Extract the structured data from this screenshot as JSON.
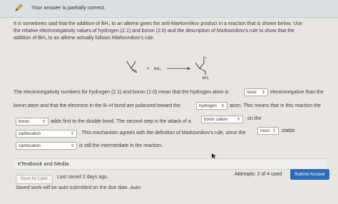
{
  "banner": {
    "message": "Your answer is partially correct."
  },
  "intro_lines": [
    "It is sometimes said that the addition of BH₃ to an alkene gives the anti-Markovnikov product in a reaction that is shown below. Use",
    "the relative electronegativity values of hydrogen (2.1) and boron (2.0) and the description of Markovnikov's rule to show that the",
    "addition of BH₃ to an alkene actually follows Markovnikov's rule."
  ],
  "reaction": {
    "plus": "+",
    "reagent": "BH₃",
    "product_top": "H",
    "product_bottom": "BH₂"
  },
  "question": {
    "line1_a": "The electronegativity numbers for hydrogen (2.1) and boron (2.0) mean that the hydrogen atom is",
    "sel1": "more",
    "line1_b": "electronegative than the",
    "line2_a": "boron atom and that the electrons in the B–H bond are polarized toward the",
    "sel2": "hydrogen",
    "line2_b": "atom. This means that in this reaction the",
    "sel3": "boron",
    "line3_a": "adds first to the double bond. The second step is the attack of a",
    "sel4": "boron cation",
    "line3_b": "on the",
    "sel5": "carbocation",
    "line4_a": ". This mechanism agrees with the definition of Markovnikov's rule, since the",
    "sel6": "most",
    "line4_b": "stable",
    "sel7": "carbocation",
    "line5_a": "is still the intermediate in the reaction."
  },
  "etextbook": "eTextbook and Media",
  "footer": {
    "save_later": "Save for Later",
    "last_saved": "Last saved 2 days ago.",
    "attempts": "Attempts: 2 of 4 used",
    "submit": "Submit Answer",
    "autosave": "Saved work will be auto-submitted on the due date. Auto-"
  },
  "colors": {
    "submit_button": "#2b6cb6",
    "banner_bg": "#dadfe4",
    "page_bg": "#e9e6e1"
  },
  "icons": {
    "banner": "pencil-icon",
    "dropdown": "updown-caret-icon"
  }
}
